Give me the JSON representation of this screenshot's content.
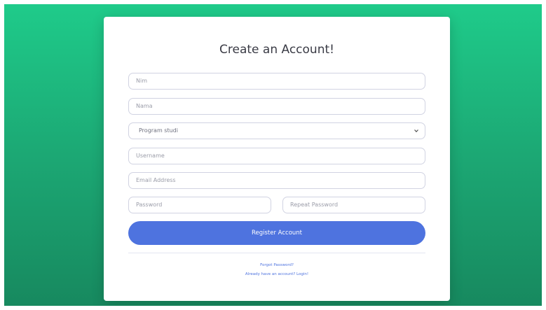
{
  "colors": {
    "background_top": "#1fcb8a",
    "background_bottom": "#17895f",
    "card": "#ffffff",
    "button": "#4e73df",
    "link": "#4e73df"
  },
  "form": {
    "title": "Create an Account!",
    "nim_placeholder": "Nim",
    "nama_placeholder": "Nama",
    "program_studi_selected": "Program studi",
    "username_placeholder": "Username",
    "email_placeholder": "Email Address",
    "password_placeholder": "Password",
    "repeat_password_placeholder": "Repeat Password",
    "register_button": "Register Account"
  },
  "links": {
    "forgot_password": "Forgot Password?",
    "login": "Already have an account? Login!"
  }
}
